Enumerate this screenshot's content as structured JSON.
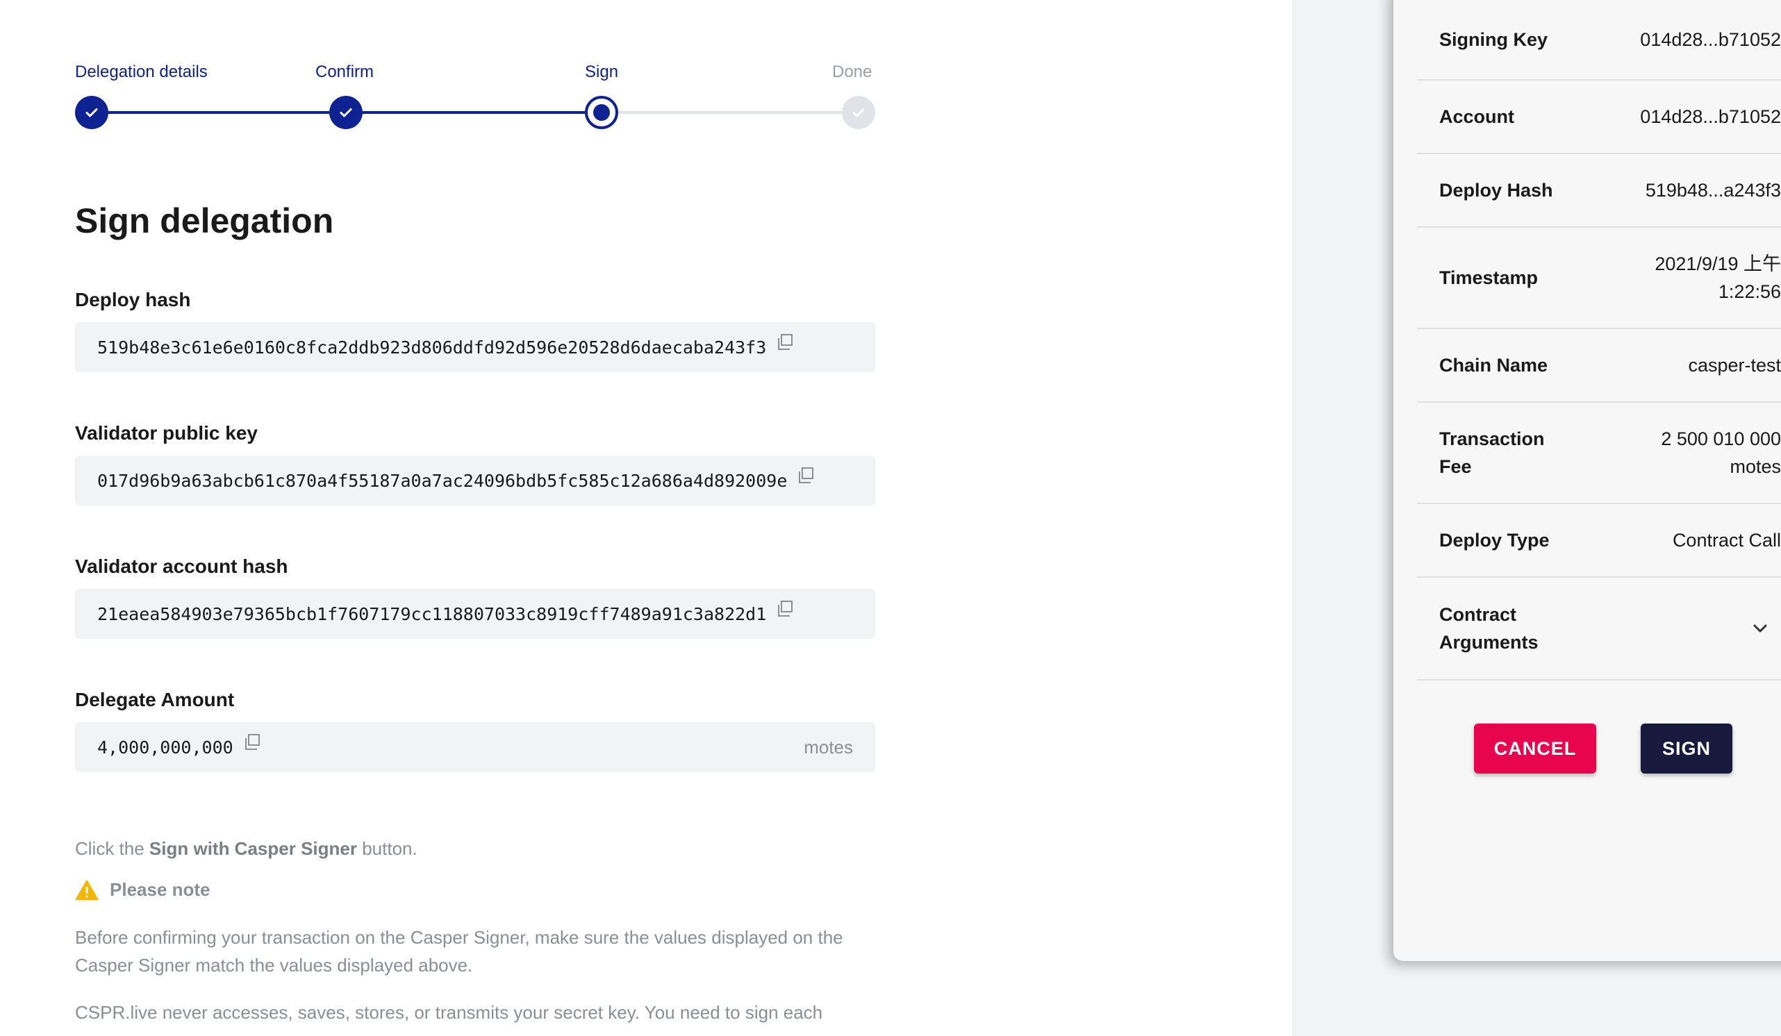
{
  "stepper": {
    "steps": [
      {
        "label": "Delegation details",
        "state": "done"
      },
      {
        "label": "Confirm",
        "state": "done"
      },
      {
        "label": "Sign",
        "state": "current"
      },
      {
        "label": "Done",
        "state": "todo"
      }
    ]
  },
  "title": "Sign delegation",
  "fields": {
    "deploy_hash": {
      "label": "Deploy hash",
      "value": "519b48e3c61e6e0160c8fca2ddb923d806ddfd92d596e20528d6daecaba243f3"
    },
    "validator_public_key": {
      "label": "Validator public key",
      "value": "017d96b9a63abcb61c870a4f55187a0a7ac24096bdb5fc585c12a686a4d892009e"
    },
    "validator_account_hash": {
      "label": "Validator account hash",
      "value": "21eaea584903e79365bcb1f7607179cc118807033c8919cff7489a91c3a822d1"
    },
    "delegate_amount": {
      "label": "Delegate Amount",
      "value": "4,000,000,000",
      "unit": "motes"
    }
  },
  "instructions": {
    "click_prefix": "Click the ",
    "click_button_name": "Sign with Casper Signer",
    "click_suffix": " button.",
    "note_title": "Please note",
    "note_text": "Before confirming your transaction on the Casper Signer, make sure the values displayed on the Casper Signer match the values displayed above.",
    "security_text": "CSPR.live never accesses, saves, stores, or transmits your secret key. You need to sign each"
  },
  "signer": {
    "rows": [
      {
        "key": "Signing Key",
        "value": "014d28...b71052"
      },
      {
        "key": "Account",
        "value": "014d28...b71052"
      },
      {
        "key": "Deploy Hash",
        "value": "519b48...a243f3"
      },
      {
        "key": "Timestamp",
        "value_line1": "2021/9/19 上午",
        "value_line2": "1:22:56"
      },
      {
        "key": "Chain Name",
        "value": "casper-test"
      },
      {
        "key_line1": "Transaction",
        "key_line2": "Fee",
        "value_line1": "2 500 010 000",
        "value_line2": "motes"
      },
      {
        "key": "Deploy Type",
        "value": "Contract Call"
      },
      {
        "key_line1": "Contract",
        "key_line2": "Arguments"
      }
    ],
    "cancel_label": "CANCEL",
    "sign_label": "SIGN"
  },
  "colors": {
    "accent": "#0e2291",
    "cancel": "#e8044f",
    "sign": "#19193d",
    "warning": "#f2b705"
  },
  "icons": {
    "copy": "copy-icon",
    "check": "check-icon",
    "warning": "warning-icon",
    "expand": "chevron-down-icon"
  }
}
